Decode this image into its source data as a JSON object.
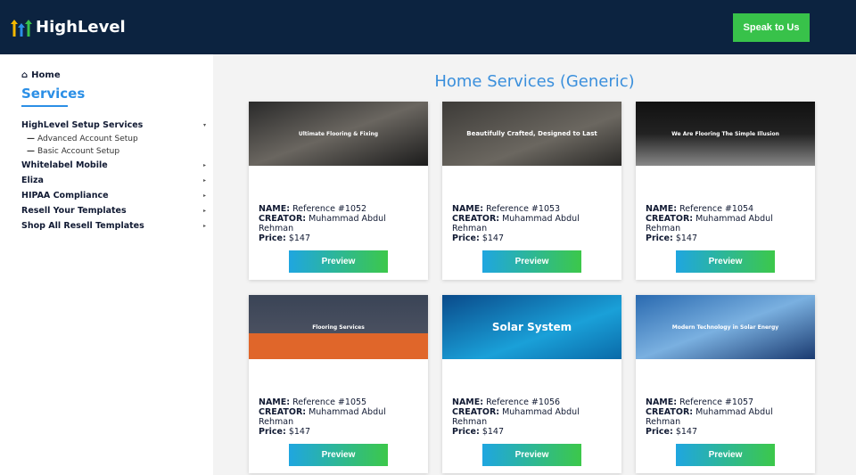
{
  "header": {
    "logo": "HighLevel",
    "cta": "Speak to Us"
  },
  "sidebar": {
    "home": "Home",
    "section": "Services",
    "items": [
      {
        "label": "HighLevel Setup Services",
        "arrow": "▾",
        "subs": [
          "Advanced Account Setup",
          "Basic Account Setup"
        ]
      },
      {
        "label": "Whitelabel Mobile",
        "arrow": "▸"
      },
      {
        "label": "Eliza",
        "arrow": "▸"
      },
      {
        "label": "HIPAA Compliance",
        "arrow": "▸"
      },
      {
        "label": "Resell Your Templates",
        "arrow": "▸"
      },
      {
        "label": "Shop All Resell Templates",
        "arrow": "▸"
      }
    ]
  },
  "main": {
    "title": "Home Services (Generic)",
    "labels": {
      "name": "NAME:",
      "creator": "CREATOR:",
      "price": "Price:"
    },
    "preview": "Preview",
    "cards": [
      {
        "name": "Reference #1052",
        "creator": "Muhammad Abdul Rehman",
        "price": "$147",
        "hero": "Ultimate Flooring & Fixing"
      },
      {
        "name": "Reference #1053",
        "creator": "Muhammad Abdul Rehman",
        "price": "$147",
        "hero": "Beautifully Crafted, Designed to Last"
      },
      {
        "name": "Reference #1054",
        "creator": "Muhammad Abdul Rehman",
        "price": "$147",
        "hero": "We Are Flooring The Simple Illusion"
      },
      {
        "name": "Reference #1055",
        "creator": "Muhammad Abdul Rehman",
        "price": "$147",
        "hero": "Flooring Services"
      },
      {
        "name": "Reference #1056",
        "creator": "Muhammad Abdul Rehman",
        "price": "$147",
        "hero": "Solar System"
      },
      {
        "name": "Reference #1057",
        "creator": "Muhammad Abdul Rehman",
        "price": "$147",
        "hero": "Modern Technology in Solar Energy"
      }
    ]
  }
}
